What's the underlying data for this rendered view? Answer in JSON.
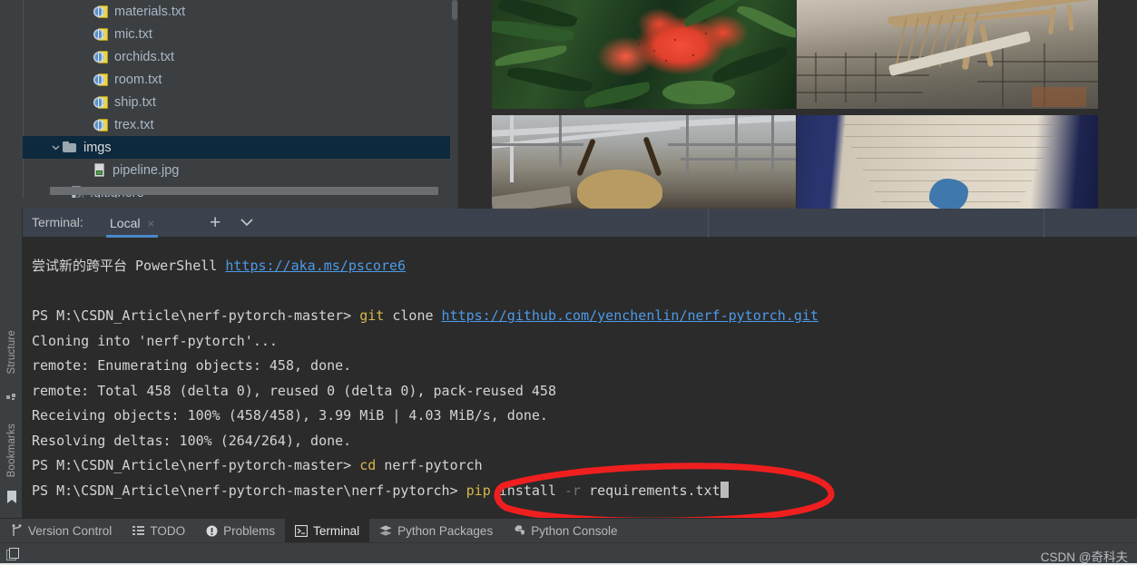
{
  "project_tree": {
    "name": "project-file-tree",
    "items": [
      {
        "label": "materials.txt",
        "icon": "txt-file-icon",
        "indent": 78,
        "selected": false,
        "arrow": ""
      },
      {
        "label": "mic.txt",
        "icon": "txt-file-icon",
        "indent": 78,
        "selected": false,
        "arrow": ""
      },
      {
        "label": "orchids.txt",
        "icon": "txt-file-icon",
        "indent": 78,
        "selected": false,
        "arrow": ""
      },
      {
        "label": "room.txt",
        "icon": "txt-file-icon",
        "indent": 78,
        "selected": false,
        "arrow": ""
      },
      {
        "label": "ship.txt",
        "icon": "txt-file-icon",
        "indent": 78,
        "selected": false,
        "arrow": ""
      },
      {
        "label": "trex.txt",
        "icon": "txt-file-icon",
        "indent": 78,
        "selected": false,
        "arrow": ""
      },
      {
        "label": "imgs",
        "icon": "folder-icon",
        "indent": 28,
        "selected": true,
        "arrow": "chevron-down"
      },
      {
        "label": "pipeline.jpg",
        "icon": "image-file-icon",
        "indent": 78,
        "selected": false,
        "arrow": ""
      },
      {
        "label": ".gitignore",
        "icon": "gitignore-file-icon",
        "indent": 53,
        "selected": false,
        "arrow": ""
      }
    ]
  },
  "preview": {
    "name": "image-preview-grid",
    "thumbnails": [
      {
        "alt": "red flowers with green foliage"
      },
      {
        "alt": "dinosaur skeleton in museum"
      },
      {
        "alt": "horned skull under metal structure"
      },
      {
        "alt": "wooden table with blue object"
      }
    ]
  },
  "tool_rail": {
    "structure_label": "Structure",
    "bookmarks_label": "Bookmarks"
  },
  "terminal": {
    "title": "Terminal:",
    "tab_label": "Local",
    "close_glyph": "×",
    "add_glyph": "+",
    "chevron_glyph": "⌄",
    "lines": [
      {
        "id": "line-powershell-banner",
        "segments": [
          {
            "text": "尝试新的跨平台 PowerShell ",
            "style": "txt"
          },
          {
            "text": "https://aka.ms/pscore6",
            "style": "link"
          }
        ]
      },
      {
        "id": "line-blank-1",
        "segments": [
          {
            "text": " ",
            "style": "txt"
          }
        ]
      },
      {
        "id": "line-git-clone",
        "segments": [
          {
            "text": "PS M:\\CSDN_Article\\nerf-pytorch-master> ",
            "style": "txt"
          },
          {
            "text": "git",
            "style": "yellow"
          },
          {
            "text": " clone ",
            "style": "txt"
          },
          {
            "text": "https://github.com/yenchenlin/nerf-pytorch.git",
            "style": "link"
          }
        ]
      },
      {
        "id": "line-cloning",
        "segments": [
          {
            "text": "Cloning into 'nerf-pytorch'...",
            "style": "txt"
          }
        ]
      },
      {
        "id": "line-enumerating",
        "segments": [
          {
            "text": "remote: Enumerating objects: 458, done.",
            "style": "txt"
          }
        ]
      },
      {
        "id": "line-total",
        "segments": [
          {
            "text": "remote: Total 458 (delta 0), reused 0 (delta 0), pack-reused 458",
            "style": "txt"
          }
        ]
      },
      {
        "id": "line-receiving",
        "segments": [
          {
            "text": "Receiving objects: 100% (458/458), 3.99 MiB | 4.03 MiB/s, done.",
            "style": "txt"
          }
        ]
      },
      {
        "id": "line-resolving",
        "segments": [
          {
            "text": "Resolving deltas: 100% (264/264), done.",
            "style": "txt"
          }
        ]
      },
      {
        "id": "line-cd",
        "segments": [
          {
            "text": "PS M:\\CSDN_Article\\nerf-pytorch-master> ",
            "style": "txt"
          },
          {
            "text": "cd",
            "style": "yellow"
          },
          {
            "text": " nerf-pytorch",
            "style": "txt"
          }
        ]
      },
      {
        "id": "line-pip-install",
        "segments": [
          {
            "text": "PS M:\\CSDN_Article\\nerf-pytorch-master\\nerf-pytorch> ",
            "style": "txt"
          },
          {
            "text": "pip",
            "style": "yellow"
          },
          {
            "text": " install ",
            "style": "txt"
          },
          {
            "text": "-r",
            "style": "dim"
          },
          {
            "text": " requirements.txt",
            "style": "txt"
          },
          {
            "text": "",
            "style": "cursor"
          }
        ]
      }
    ]
  },
  "bottom_bar": {
    "items": [
      {
        "label": "Version Control",
        "icon": "branch-icon",
        "active": false
      },
      {
        "label": "TODO",
        "icon": "list-icon",
        "active": false
      },
      {
        "label": "Problems",
        "icon": "warning-icon",
        "active": false
      },
      {
        "label": "Terminal",
        "icon": "terminal-icon",
        "active": true
      },
      {
        "label": "Python Packages",
        "icon": "layers-icon",
        "active": false
      },
      {
        "label": "Python Console",
        "icon": "python-icon",
        "active": false
      }
    ]
  },
  "status_bar": {
    "watermark": "CSDN @奇科夫"
  },
  "colors": {
    "accent_blue": "#4a88c7",
    "selection_blue": "#0d293e",
    "terminal_bg": "#2b2b2b",
    "panel_bg": "#3c3f41",
    "tabbar_bg": "#3c424d",
    "link": "#4d9ae8",
    "keyword_yellow": "#d6b74b",
    "annotation_red": "#f01f1f"
  }
}
